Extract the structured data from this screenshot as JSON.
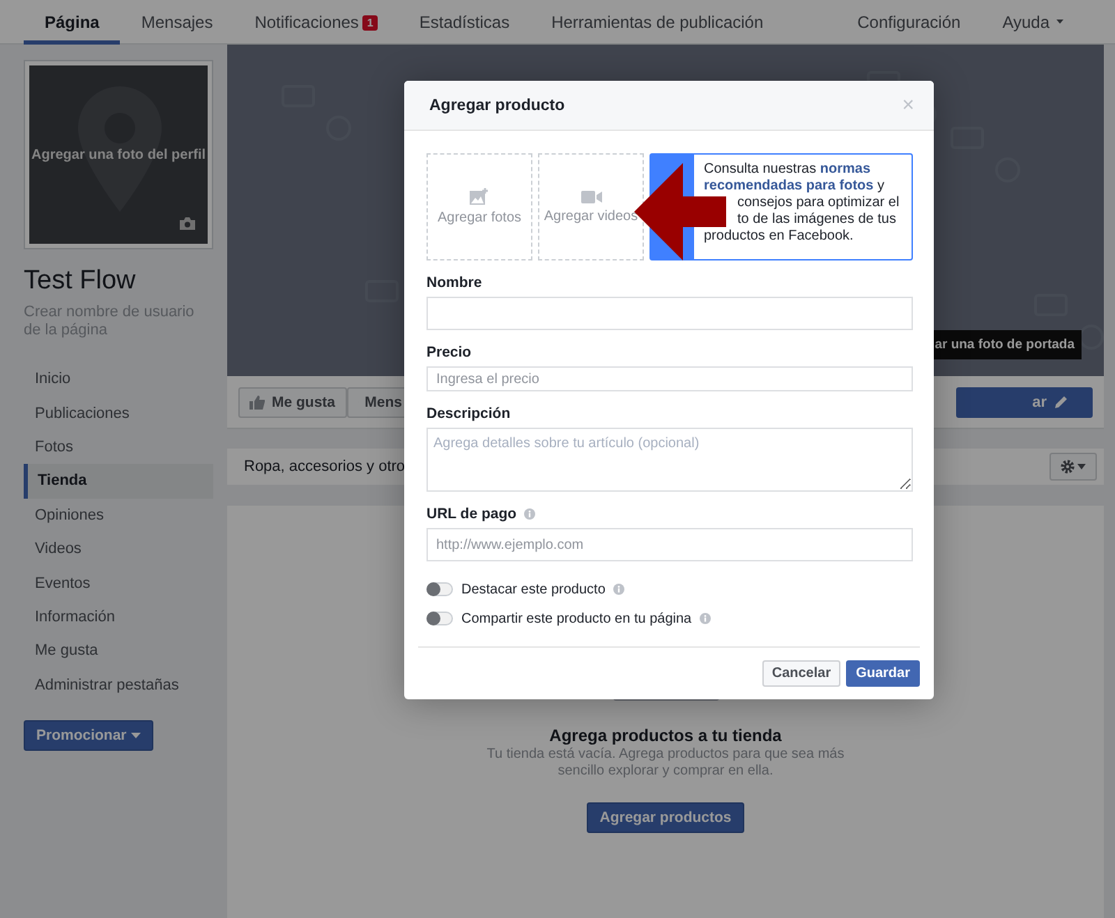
{
  "topnav": {
    "tabs": [
      {
        "label": "Página",
        "selected": true
      },
      {
        "label": "Mensajes",
        "selected": false
      },
      {
        "label": "Notificaciones",
        "selected": false,
        "badge": "1"
      },
      {
        "label": "Estadísticas",
        "selected": false
      },
      {
        "label": "Herramientas de publicación",
        "selected": false
      }
    ],
    "right": [
      {
        "label": "Configuración",
        "kind": "link"
      },
      {
        "label": "Ayuda",
        "kind": "menu"
      }
    ]
  },
  "profile": {
    "photo_label": "Agregar una foto del perfil",
    "name": "Test Flow",
    "username_hint": "Crear nombre de usuario de la página"
  },
  "sidebar": {
    "items": [
      {
        "label": "Inicio",
        "selected": false
      },
      {
        "label": "Publicaciones",
        "selected": false
      },
      {
        "label": "Fotos",
        "selected": false
      },
      {
        "label": "Tienda",
        "selected": true
      },
      {
        "label": "Opiniones",
        "selected": false
      },
      {
        "label": "Videos",
        "selected": false
      },
      {
        "label": "Eventos",
        "selected": false
      },
      {
        "label": "Información",
        "selected": false
      },
      {
        "label": "Me gusta",
        "selected": false
      },
      {
        "label": "Administrar pestañas",
        "selected": false
      }
    ],
    "promote_button": "Promocionar"
  },
  "cover": {
    "button": "ar una foto de portada"
  },
  "actions": [
    {
      "label": "Me gusta",
      "kind": "like"
    },
    {
      "label": "Mens",
      "kind": "message"
    }
  ],
  "primary_action": "ar",
  "shop": {
    "title": "Ropa, accesorios y otro",
    "empty_title": "Agrega productos a tu tienda",
    "empty_text": "Tu tienda está vacía. Agrega productos para que sea más sencillo explorar y comprar en ella.",
    "button": "Agregar productos"
  },
  "dialog": {
    "title": "Agregar producto",
    "close": "×",
    "uploads": [
      {
        "label": "Agregar fotos",
        "kind": "photo"
      },
      {
        "label": "Agregar videos",
        "kind": "video"
      }
    ],
    "info_lines": [
      {
        "text": "Consulta nuestras **normas**",
        "covered": false
      },
      {
        "text": "**recomendadas para fotos** y",
        "covered": false
      },
      {
        "text": "consejos para optimizar el",
        "covered": true
      },
      {
        "text": "to de las imágenes de tus",
        "covered": true
      },
      {
        "text": "productos en Facebook.",
        "covered": false
      }
    ],
    "fields": [
      {
        "label": "Nombre",
        "kind": "large"
      },
      {
        "label": "Precio",
        "kind": "small",
        "placeholder": "Ingresa el precio"
      },
      {
        "label": "Descripción",
        "kind": "textarea",
        "placeholder": "Agrega detalles sobre tu artículo (opcional)"
      },
      {
        "label": "URL de pago",
        "kind": "large",
        "placeholder": "http://www.ejemplo.com",
        "info": true
      }
    ],
    "toggles": [
      {
        "label": "Destacar este producto",
        "on": false
      },
      {
        "label": "Compartir este producto en tu página",
        "on": false
      }
    ],
    "buttons": [
      {
        "label": "Cancelar",
        "primary": false
      },
      {
        "label": "Guardar",
        "primary": true
      }
    ]
  }
}
